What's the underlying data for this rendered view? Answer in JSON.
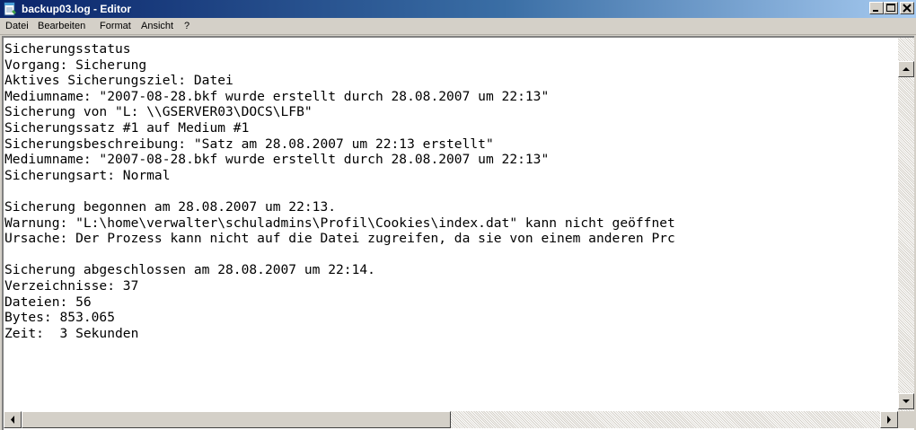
{
  "window": {
    "title": "backup03.log - Editor",
    "app_icon": "notepad-icon",
    "controls": {
      "minimize": "minimize-icon",
      "maximize": "maximize-icon",
      "close": "close-icon"
    }
  },
  "menu": {
    "items": [
      {
        "label": "Datei"
      },
      {
        "label": "Bearbeiten"
      },
      {
        "label": "Format"
      },
      {
        "label": "Ansicht"
      },
      {
        "label": "?"
      }
    ]
  },
  "document": {
    "lines": [
      "Sicherungsstatus",
      "Vorgang: Sicherung",
      "Aktives Sicherungsziel: Datei",
      "Mediumname: \"2007-08-28.bkf wurde erstellt durch 28.08.2007 um 22:13\"",
      "Sicherung von \"L: \\\\GSERVER03\\DOCS\\LFB\"",
      "Sicherungssatz #1 auf Medium #1",
      "Sicherungsbeschreibung: \"Satz am 28.08.2007 um 22:13 erstellt\"",
      "Mediumname: \"2007-08-28.bkf wurde erstellt durch 28.08.2007 um 22:13\"",
      "Sicherungsart: Normal",
      "",
      "Sicherung begonnen am 28.08.2007 um 22:13.",
      "Warnung: \"L:\\home\\verwalter\\schuladmins\\Profil\\Cookies\\index.dat\" kann nicht geöffnet",
      "Ursache: Der Prozess kann nicht auf die Datei zugreifen, da sie von einem anderen Prc",
      "",
      "Sicherung abgeschlossen am 28.08.2007 um 22:14.",
      "Verzeichnisse: 37",
      "Dateien: 56",
      "Bytes: 853.065",
      "Zeit:  3 Sekunden"
    ]
  },
  "scrollbars": {
    "vertical": {
      "up": "arrow-up-icon",
      "down": "arrow-down-icon"
    },
    "horizontal": {
      "left": "arrow-left-icon",
      "right": "arrow-right-icon"
    }
  },
  "colors": {
    "titlebar_start": "#0a246a",
    "titlebar_end": "#a6caf0",
    "chrome": "#d4d0c8",
    "text": "#000000",
    "editor_background": "#ffffff"
  }
}
